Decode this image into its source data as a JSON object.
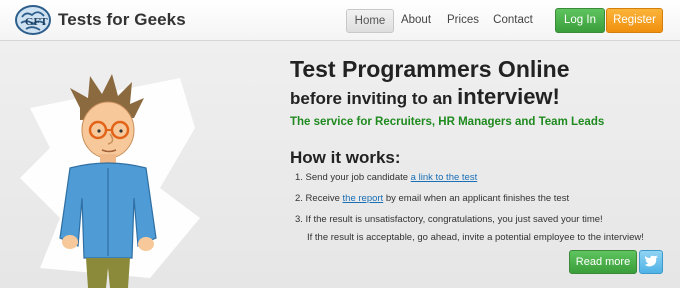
{
  "header": {
    "brand": "Tests for Geeks",
    "nav": [
      "Home",
      "About",
      "Prices",
      "Contact"
    ],
    "login_label": "Log In",
    "register_label": "Register"
  },
  "hero": {
    "title_line1": "Test Programmers Online",
    "title_line2_prefix": "before inviting to an ",
    "title_line2_emphasis": "interview!",
    "tagline": "The service for Recruiters, HR Managers and Team Leads",
    "how_heading": "How it works:",
    "steps": [
      {
        "prefix": "1. Send your job candidate ",
        "link": "a link to the test",
        "suffix": ""
      },
      {
        "prefix": "2. Receive ",
        "link": "the report",
        "suffix": " by email when an applicant finishes the test"
      },
      {
        "prefix": "3. If the result is unsatisfactory, congratulations, you just saved your time!",
        "link": "",
        "suffix": ""
      }
    ],
    "step3_line2": "If the result is acceptable, go ahead, invite a potential employee to the interview!",
    "read_more_label": "Read more"
  },
  "colors": {
    "brand_green": "#3a9e3a",
    "register_orange": "#f0900e",
    "tagline_green": "#1f8a1f",
    "link_blue": "#1a6fb5",
    "twitter_blue": "#4fb2e6"
  },
  "icons": {
    "logo": "brain-logo-icon",
    "social": "twitter-bird-icon",
    "illustration": "geek-character"
  }
}
